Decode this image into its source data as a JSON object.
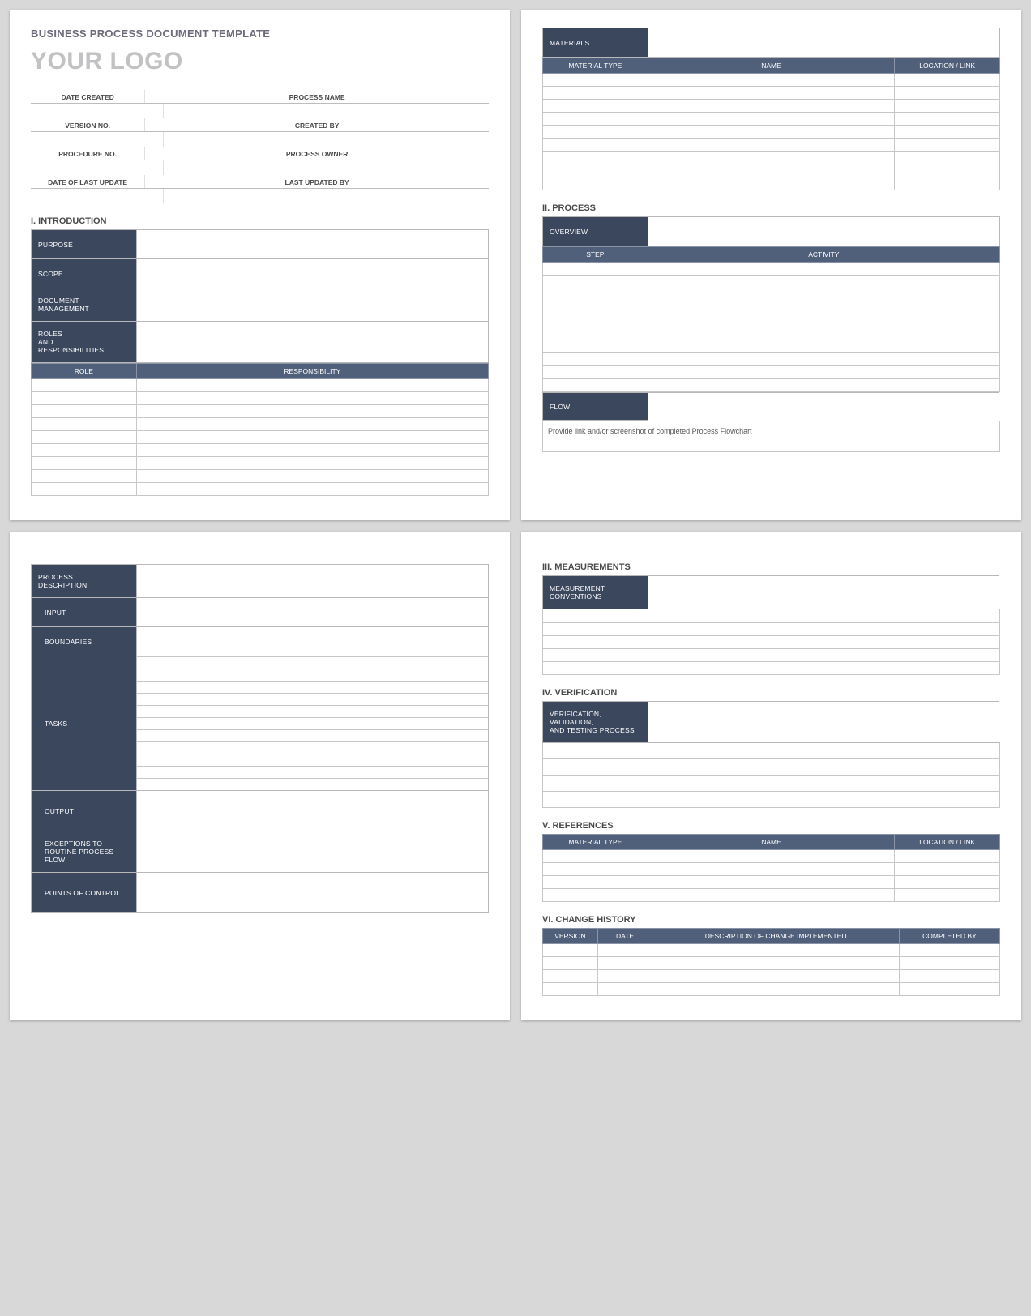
{
  "title": "BUSINESS PROCESS DOCUMENT TEMPLATE",
  "logo": "YOUR LOGO",
  "meta": {
    "date_created": "DATE CREATED",
    "process_name": "PROCESS NAME",
    "version_no": "VERSION NO.",
    "created_by": "CREATED BY",
    "procedure_no": "PROCEDURE NO.",
    "process_owner": "PROCESS OWNER",
    "date_last_update": "DATE OF LAST UPDATE",
    "last_updated_by": "LAST UPDATED BY"
  },
  "s1": {
    "heading": "I.   INTRODUCTION",
    "purpose": "PURPOSE",
    "scope": "SCOPE",
    "doc_mgmt": "DOCUMENT MANAGEMENT",
    "roles_resp": "ROLES\nAND\nRESPONSIBILITIES",
    "role": "ROLE",
    "responsibility": "RESPONSIBILITY"
  },
  "materials": {
    "label": "MATERIALS",
    "type": "MATERIAL TYPE",
    "name": "NAME",
    "loc": "LOCATION / LINK"
  },
  "s2": {
    "heading": "II.   PROCESS",
    "overview": "OVERVIEW",
    "step": "STEP",
    "activity": "ACTIVITY",
    "flow": "FLOW",
    "flow_note": "Provide link and/or screenshot of completed Process Flowchart"
  },
  "s3": {
    "proc_desc": "PROCESS\nDESCRIPTION",
    "input": "INPUT",
    "boundaries": "BOUNDARIES",
    "tasks": "TASKS",
    "output": "OUTPUT",
    "exceptions": "EXCEPTIONS TO\nROUTINE PROCESS FLOW",
    "points": "POINTS OF CONTROL"
  },
  "s4": {
    "meas_heading": "III.  MEASUREMENTS",
    "meas_conv": "MEASUREMENT\nCONVENTIONS",
    "ver_heading": "IV.  VERIFICATION",
    "ver_label": "VERIFICATION, VALIDATION,\nAND TESTING PROCESS",
    "ref_heading": "V.   REFERENCES",
    "ref_type": "MATERIAL TYPE",
    "ref_name": "NAME",
    "ref_loc": "LOCATION / LINK",
    "change_heading": "VI.  CHANGE HISTORY",
    "ch_version": "VERSION",
    "ch_date": "DATE",
    "ch_desc": "DESCRIPTION OF CHANGE IMPLEMENTED",
    "ch_by": "COMPLETED BY"
  }
}
